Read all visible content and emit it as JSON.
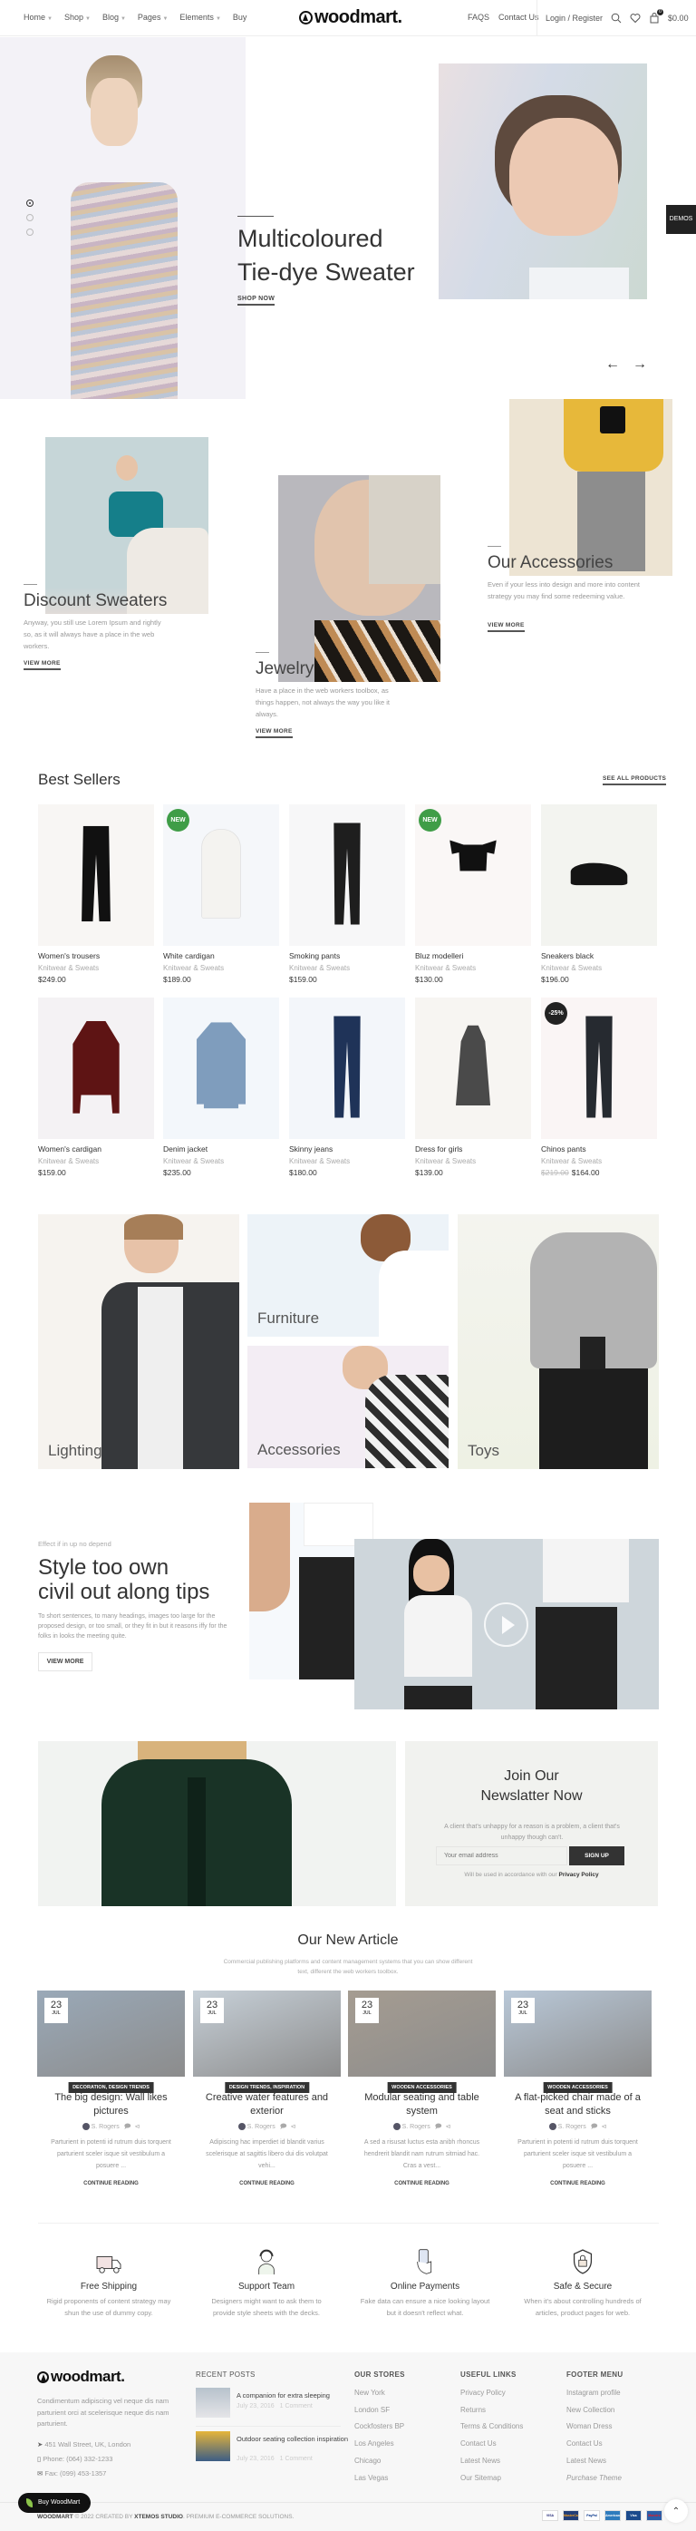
{
  "header": {
    "nav": [
      {
        "label": "Home"
      },
      {
        "label": "Shop"
      },
      {
        "label": "Blog"
      },
      {
        "label": "Pages"
      },
      {
        "label": "Elements"
      },
      {
        "label": "Buy"
      }
    ],
    "logo": "woodmart.",
    "faqs": "FAQS",
    "contact": "Contact Us",
    "login": "Login / Register",
    "cart_count": "0",
    "cart_total": "$0.00"
  },
  "hero": {
    "title_line1": "Multicoloured",
    "title_line2": "Tie-dye Sweater",
    "cta": "SHOP NOW",
    "slides": 3,
    "active_slide": 1,
    "demos_tab": "DEMOS"
  },
  "categories": [
    {
      "title": "Discount Sweaters",
      "text": "Anyway, you still use Lorem Ipsum and rightly so, as it will always have a place in the web workers.",
      "link": "VIEW MORE"
    },
    {
      "title": "Jewelry",
      "text": "Have a place in the web workers toolbox, as things happen, not always the way you like it always.",
      "link": "VIEW MORE"
    },
    {
      "title": "Our Accessories",
      "text": "Even if your less into design and more into content strategy you may find some redeeming value.",
      "link": "VIEW MORE"
    }
  ],
  "best_sellers": {
    "title": "Best Sellers",
    "see_all": "SEE ALL PRODUCTS",
    "products": [
      {
        "name": "Women's trousers",
        "category": "Knitwear & Sweats",
        "price": "$249.00",
        "badge": "",
        "bg": "#f8f6f4",
        "item": "trousers",
        "color": "#111"
      },
      {
        "name": "White cardigan",
        "category": "Knitwear & Sweats",
        "price": "$189.00",
        "badge": "NEW",
        "bg": "#f5f7fa",
        "item": "hoodie",
        "color": "#f4f3f0"
      },
      {
        "name": "Smoking pants",
        "category": "Knitwear & Sweats",
        "price": "$159.00",
        "badge": "",
        "bg": "#f7f7f8",
        "item": "jeans",
        "color": "#1e1e1e"
      },
      {
        "name": "Bluz modelleri",
        "category": "Knitwear & Sweats",
        "price": "$130.00",
        "badge": "NEW",
        "bg": "#faf7f6",
        "item": "top",
        "color": "#111"
      },
      {
        "name": "Sneakers black",
        "category": "Knitwear & Sweats",
        "price": "$196.00",
        "badge": "",
        "bg": "#f3f4f0",
        "item": "shoes",
        "color": "#141414"
      },
      {
        "name": "Women's cardigan",
        "category": "Knitwear & Sweats",
        "price": "$159.00",
        "badge": "",
        "bg": "#f4f2f4",
        "item": "sweater",
        "color": "#5e1414"
      },
      {
        "name": "Denim jacket",
        "category": "Knitwear & Sweats",
        "price": "$235.00",
        "badge": "",
        "bg": "#f3f7fb",
        "item": "jacket",
        "color": "#7f9dbd"
      },
      {
        "name": "Skinny jeans",
        "category": "Knitwear & Sweats",
        "price": "$180.00",
        "badge": "",
        "bg": "#f3f6fa",
        "item": "jeans",
        "color": "#1f3358"
      },
      {
        "name": "Dress for girls",
        "category": "Knitwear & Sweats",
        "price": "$139.00",
        "badge": "",
        "bg": "#f7f5f2",
        "item": "dress",
        "color": "#4a4a4a"
      },
      {
        "name": "Chinos pants",
        "category": "Knitwear & Sweats",
        "price": "$164.00",
        "old_price": "$219.00",
        "badge": "-25%",
        "bg": "#faf5f5",
        "item": "jeans",
        "color": "#262a30"
      }
    ],
    "badge_colors": {
      "NEW": "#3f9d47",
      "-25%": "#222222"
    }
  },
  "banners": [
    {
      "label": "Lighting"
    },
    {
      "label": "Furniture"
    },
    {
      "label": "Accessories"
    },
    {
      "label": "Toys"
    }
  ],
  "style_section": {
    "eyebrow": "Effect if in up no depend",
    "title_line1": "Style too own",
    "title_line2": "civil out along tips",
    "text": "To short sentences, to many headings, images too large for the proposed design, or too small, or they fit in but it reasons iffy for the folks in looks the meeting quite.",
    "button": "VIEW MORE"
  },
  "newsletter": {
    "title_line1": "Join Our",
    "title_line2": "Newslatter Now",
    "text": "A client that's unhappy for a reason is a problem, a client that's unhappy though can't.",
    "placeholder": "Your email address",
    "button": "SIGN UP",
    "note": "Will be used in accordance with our",
    "note_link": "Privacy Policy"
  },
  "articles": {
    "title": "Our New Article",
    "subtitle": "Commercial publishing platforms and content management systems that you can show different text, different the web workers toolbox.",
    "items": [
      {
        "day": "23",
        "month": "JUL",
        "category": "DECORATION, DESIGN TRENDS",
        "title": "The big design: Wall likes pictures",
        "author": "S. Rogers",
        "excerpt": "Parturient in potenti id rutrum duis torquent parturient sceler isque sit vestibulum a posuere ...",
        "link": "CONTINUE READING",
        "bg": "#9aa9b8"
      },
      {
        "day": "23",
        "month": "JUL",
        "category": "DESIGN TRENDS, INSPIRATION",
        "title": "Creative water features and exterior",
        "author": "S. Rogers",
        "excerpt": "Adipiscing hac imperdiet id blandit varius scelerisque at sagittis libero dui dis volutpat vehi...",
        "link": "CONTINUE READING",
        "bg": "#c7d0d8"
      },
      {
        "day": "23",
        "month": "JUL",
        "category": "WOODEN ACCESSORIES",
        "title": "Modular seating and table system",
        "author": "S. Rogers",
        "excerpt": "A sed a risusat luctus esta anibh rhoncus hendrerit blandit nam rutrum sitmiad hac. Cras a vest...",
        "link": "CONTINUE READING",
        "bg": "#a59c91"
      },
      {
        "day": "23",
        "month": "JUL",
        "category": "WOODEN ACCESSORIES",
        "title": "A flat-picked chair made of a seat and sticks",
        "author": "S. Rogers",
        "excerpt": "Parturient in potenti id rutrum duis torquent parturient sceler isque sit vestibulum a posuere ...",
        "link": "CONTINUE READING",
        "bg": "#b9c8d8"
      }
    ]
  },
  "features": [
    {
      "icon": "truck-icon",
      "title": "Free Shipping",
      "text": "Rigid proponents of content strategy may shun the use of dummy copy."
    },
    {
      "icon": "support-agent-icon",
      "title": "Support Team",
      "text": "Designers might want to ask them to provide style sheets with the decks."
    },
    {
      "icon": "card-payment-icon",
      "title": "Online Payments",
      "text": "Fake data can ensure a nice looking layout but it doesn't reflect what."
    },
    {
      "icon": "shield-lock-icon",
      "title": "Safe & Secure",
      "text": "When it's about controlling hundreds of articles, product pages for web."
    }
  ],
  "footer": {
    "logo": "woodmart.",
    "about": "Condimentum adipiscing vel neque dis nam parturient orci at scelerisque neque dis nam parturient.",
    "address": "451 Wall Street, UK, London",
    "phone": "Phone: (064) 332-1233",
    "fax": "Fax: (099) 453-1357",
    "recent_title": "RECENT POSTS",
    "recent": [
      {
        "title": "A companion for extra sleeping",
        "date": "July 23, 2016",
        "comments": "1 Comment"
      },
      {
        "title": "Outdoor seating collection inspiration",
        "date": "July 23, 2016",
        "comments": "1 Comment"
      }
    ],
    "columns": [
      {
        "title": "OUR STORES",
        "links": [
          "New York",
          "London SF",
          "Cockfosters BP",
          "Los Angeles",
          "Chicago",
          "Las Vegas"
        ]
      },
      {
        "title": "USEFUL LINKS",
        "links": [
          "Privacy Policy",
          "Returns",
          "Terms & Conditions",
          "Contact Us",
          "Latest News",
          "Our Sitemap"
        ]
      },
      {
        "title": "FOOTER MENU",
        "links": [
          "Instagram profile",
          "New Collection",
          "Woman Dress",
          "Contact Us",
          "Latest News",
          "Purchase Theme"
        ]
      }
    ],
    "copyright_brand": "WOODMART",
    "copyright_mid": "© 2022 CREATED BY",
    "copyright_studio": "XTEMOS STUDIO",
    "copyright_end": ". PREMIUM E-COMMERCE SOLUTIONS.",
    "payments": [
      "VISA",
      "MasterCard",
      "PayPal",
      "American Express",
      "Visa Electron",
      "Maestro"
    ],
    "buy_button": "Buy WoodMart"
  }
}
